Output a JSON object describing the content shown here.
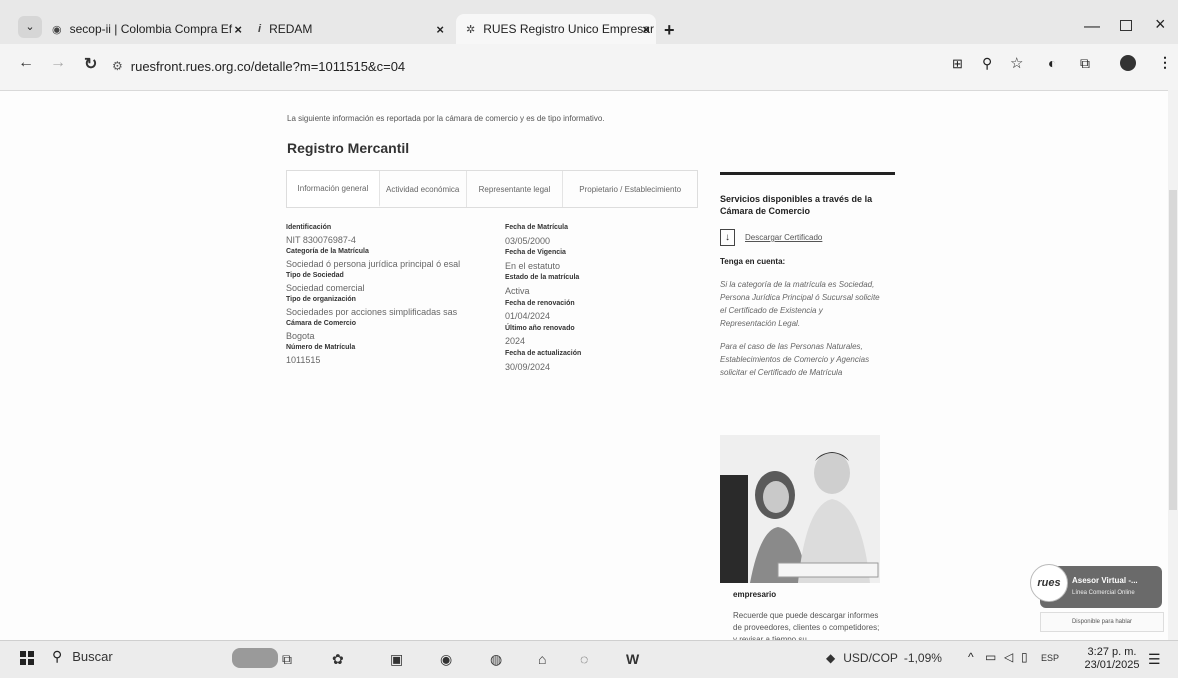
{
  "browser": {
    "tabs": [
      {
        "label": "secop-ii | Colombia Compra Ef",
        "icon": "globe-icon"
      },
      {
        "label": "REDAM",
        "icon": "info-icon"
      },
      {
        "label": "RUES Registro Unico Empresar",
        "icon": "rues-icon"
      }
    ],
    "url": "ruesfront.rues.org.co/detalle?m=1011515&c=04"
  },
  "page": {
    "intro": "La siguiente información es reportada por la cámara de comercio y es de tipo informativo.",
    "title": "Registro Mercantil",
    "tabs": [
      "Información general",
      "Actividad económica",
      "Representante legal",
      "Propietario / Establecimiento"
    ],
    "left_fields": [
      {
        "label": "Identificación",
        "value": "NIT 830076987-4"
      },
      {
        "label": "Categoría de la Matrícula",
        "value": "Sociedad ó persona jurídica principal ó esal"
      },
      {
        "label": "Tipo de Sociedad",
        "value": "Sociedad comercial"
      },
      {
        "label": "Tipo de organización",
        "value": "Sociedades por acciones simplificadas sas"
      },
      {
        "label": "Cámara de Comercio",
        "value": "Bogota"
      },
      {
        "label": "Número de Matrícula",
        "value": "1011515"
      }
    ],
    "right_fields": [
      {
        "label": "Fecha de Matrícula",
        "value": "03/05/2000"
      },
      {
        "label": "Fecha de Vigencia",
        "value": "En el estatuto"
      },
      {
        "label": "Estado de la matrícula",
        "value": "Activa"
      },
      {
        "label": "Fecha de renovación",
        "value": "01/04/2024"
      },
      {
        "label": "Último año renovado",
        "value": "2024"
      },
      {
        "label": "Fecha de actualización",
        "value": "30/09/2024"
      }
    ]
  },
  "sidebar": {
    "heading": "Servicios disponibles a través de la Cámara de Comercio",
    "download": "Descargar Certificado",
    "tenga": "Tenga en cuenta:",
    "note1": "Si la categoría de la matrícula es Sociedad, Persona Jurídica Principal ó Sucursal solicite el Certificado de Existencia y Representación Legal.",
    "note2": "Para el caso de las Personas Naturales, Establecimientos de Comercio y Agencias solicitar el Certificado de Matrícula",
    "card_title": "empresario",
    "card_text": "Recuerde que puede descargar informes de proveedores, clientes o competidores; y revisar a tiempo su"
  },
  "chat": {
    "brand": "rues",
    "title": "Asesor Virtual -...",
    "subtitle": "Línea Comercial Online",
    "tooltip": "Disponible para hablar"
  },
  "taskbar": {
    "search": "Buscar",
    "ticker": "USD/COP",
    "change": "-1,09%",
    "lang": "ESP",
    "time": "3:27 p. m.",
    "date": "23/01/2025"
  }
}
